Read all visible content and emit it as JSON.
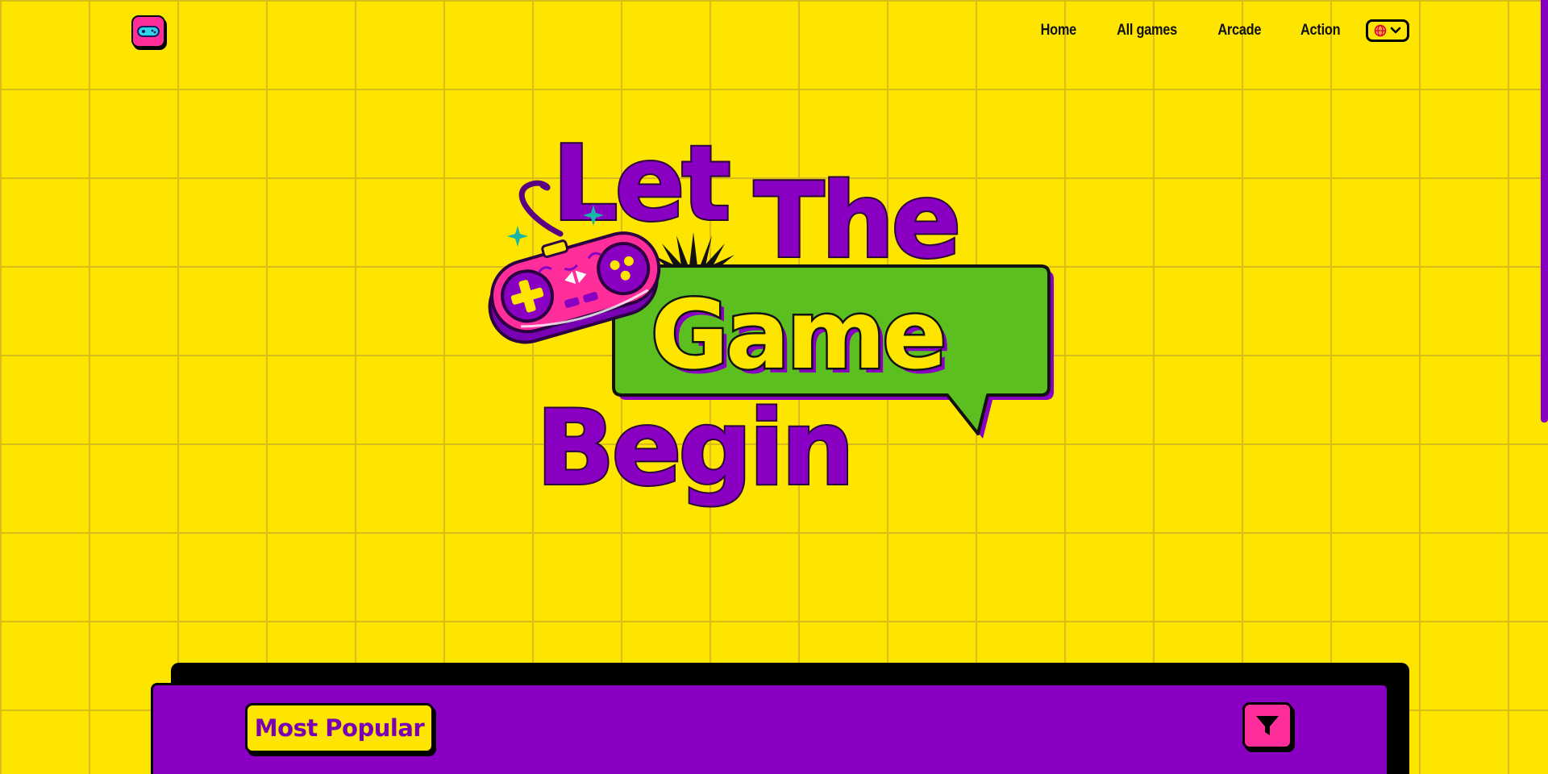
{
  "header": {
    "logo_icon": "gamepad-icon",
    "nav": [
      {
        "label": "Home"
      },
      {
        "label": "All games"
      },
      {
        "label": "Arcade"
      },
      {
        "label": "Action"
      }
    ],
    "language_icon": "globe-icon",
    "language_chevron": "chevron-down-icon"
  },
  "hero": {
    "line1": "Let",
    "line2": "The",
    "line3": "Game",
    "line4": "Begin",
    "illustration_icon": "gamepad-icon"
  },
  "panel": {
    "tab_label": "Most Popular",
    "filter_icon": "filter-icon"
  },
  "colors": {
    "background": "#FDE500",
    "purple": "#8A00C2",
    "pink": "#FF2E9A",
    "green": "#5CBF20",
    "teal": "#16B6A8"
  }
}
